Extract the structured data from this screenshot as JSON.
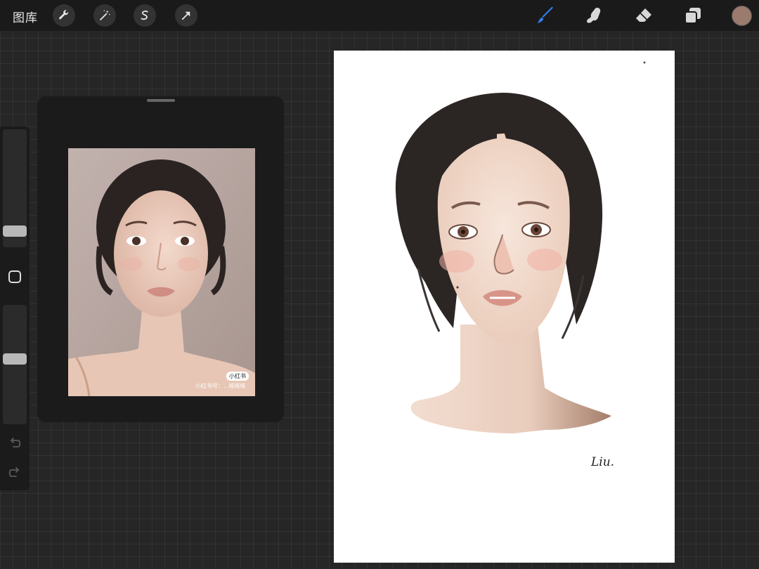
{
  "toolbar": {
    "gallery_label": "图库",
    "left_tools": [
      {
        "name": "actions",
        "icon": "wrench-icon"
      },
      {
        "name": "adjustments",
        "icon": "magic-wand-icon"
      },
      {
        "name": "selection",
        "icon": "selection-s-icon"
      },
      {
        "name": "transform",
        "icon": "arrow-cursor-icon"
      }
    ],
    "right_tools": [
      {
        "name": "brush",
        "icon": "brush-icon",
        "active": true
      },
      {
        "name": "smudge",
        "icon": "smudge-finger-icon"
      },
      {
        "name": "eraser",
        "icon": "eraser-icon"
      },
      {
        "name": "layers",
        "icon": "layers-icon"
      }
    ],
    "current_color": "#9b7b6d",
    "active_tool_color": "#2f7dea"
  },
  "sidebar": {
    "brush_size_level": 0.1,
    "opacity_level": 0.55,
    "modify_icon": "square-icon",
    "undo_icon": "undo-icon",
    "redo_icon": "redo-icon"
  },
  "reference": {
    "badge_text": "小红书",
    "watermark_text": "小红书号：...咳咳咳"
  },
  "canvas": {
    "signature": "Liu."
  }
}
